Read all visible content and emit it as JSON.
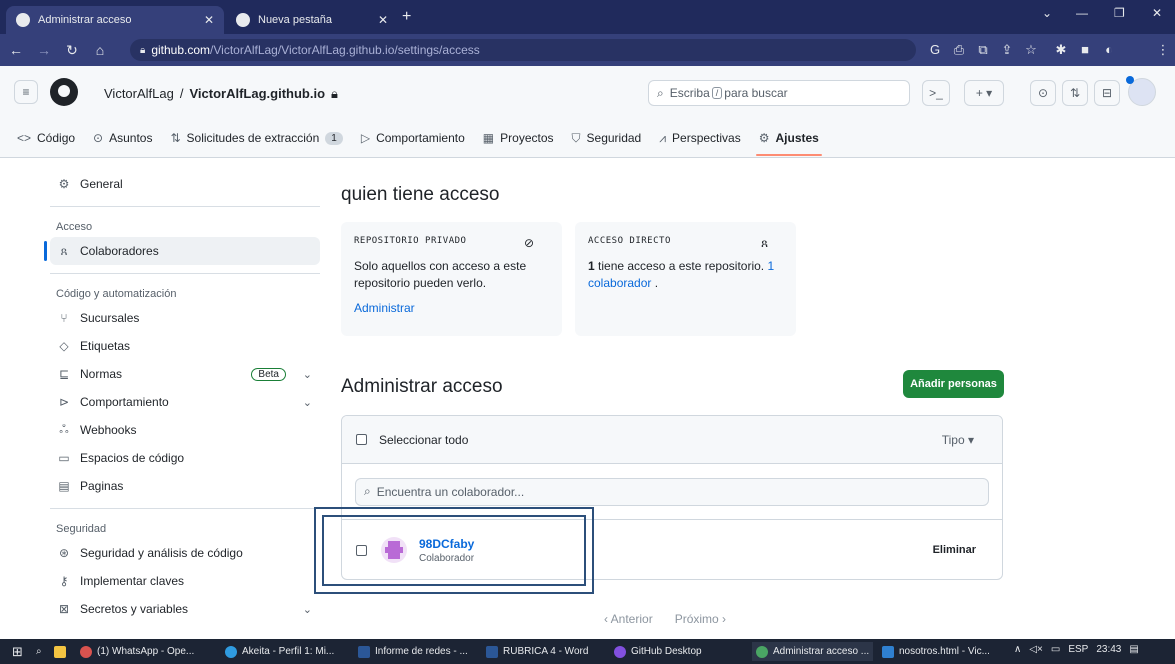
{
  "browser": {
    "tabs": [
      {
        "title": "Administrar acceso",
        "active": true
      },
      {
        "title": "Nueva pestaña",
        "active": false
      }
    ],
    "new_tab": "+",
    "window_controls": {
      "minimize": "—",
      "maximize": "❐",
      "close": "✕",
      "dropdown": "⌄"
    },
    "url_host": "github.com",
    "url_path": "/VictorAlfLag/VictorAlfLag.github.io/settings/access"
  },
  "header": {
    "owner": "VictorAlfLag",
    "separator": "/",
    "repo": "VictorAlfLag.github.io",
    "search_prefix": "Escriba",
    "search_key": "/",
    "search_suffix": "para buscar"
  },
  "repo_nav": [
    {
      "icon": "code-icon",
      "glyph": "<>",
      "label": "Código"
    },
    {
      "icon": "issue-icon",
      "glyph": "⊙",
      "label": "Asuntos"
    },
    {
      "icon": "pull-request-icon",
      "glyph": "⇅",
      "label": "Solicitudes de extracción",
      "count": "1"
    },
    {
      "icon": "actions-icon",
      "glyph": "▷",
      "label": "Comportamiento"
    },
    {
      "icon": "projects-icon",
      "glyph": "▦",
      "label": "Proyectos"
    },
    {
      "icon": "security-icon",
      "glyph": "⛉",
      "label": "Seguridad"
    },
    {
      "icon": "insights-icon",
      "glyph": "⩘",
      "label": "Perspectivas"
    },
    {
      "icon": "gear-icon",
      "glyph": "⚙",
      "label": "Ajustes",
      "selected": true
    }
  ],
  "sidebar": {
    "general": "General",
    "access_heading": "Acceso",
    "collaborators": "Colaboradores",
    "code_heading": "Código y automatización",
    "branches": "Sucursales",
    "tags": "Etiquetas",
    "rules": "Normas",
    "rules_badge": "Beta",
    "actions": "Comportamiento",
    "webhooks": "Webhooks",
    "codespaces": "Espacios de código",
    "pages": "Paginas",
    "security_heading": "Seguridad",
    "code_security": "Seguridad y análisis de código",
    "deploy_keys": "Implementar claves",
    "secrets": "Secretos y variables"
  },
  "main": {
    "who_title": "quien tiene acceso",
    "private_card": {
      "label": "REPOSITORIO PRIVADO",
      "text": "Solo aquellos con acceso a este repositorio pueden verlo.",
      "link": "Administrar"
    },
    "direct_card": {
      "label": "ACCESO DIRECTO",
      "count": "1",
      "text": " tiene acceso a este repositorio. ",
      "link_count": "1",
      "link": "colaborador",
      "tail": " ."
    },
    "manage_title": "Administrar acceso",
    "add_button": "Añadir personas",
    "select_all": "Seleccionar todo",
    "type_filter": "Tipo ▾",
    "filter_placeholder": "Encuentra un colaborador...",
    "member": {
      "name": "98DCfaby",
      "role": "Colaborador"
    },
    "remove": "Eliminar",
    "pager_prev": "‹  Anterior",
    "pager_next": "Próximo  ›"
  },
  "taskbar": {
    "items": [
      "(1) WhatsApp - Ope...",
      "Akeita - Perfil 1: Mi...",
      "Informe de redes - ...",
      "RUBRICA 4 - Word",
      "GitHub Desktop",
      "Administrar acceso ...",
      "nosotros.html - Vic..."
    ],
    "language": "ESP",
    "time": "23:43"
  },
  "colors": {
    "accent": "#0969da",
    "primary_button": "#1f883d",
    "selected_underline": "#fd8c73"
  }
}
